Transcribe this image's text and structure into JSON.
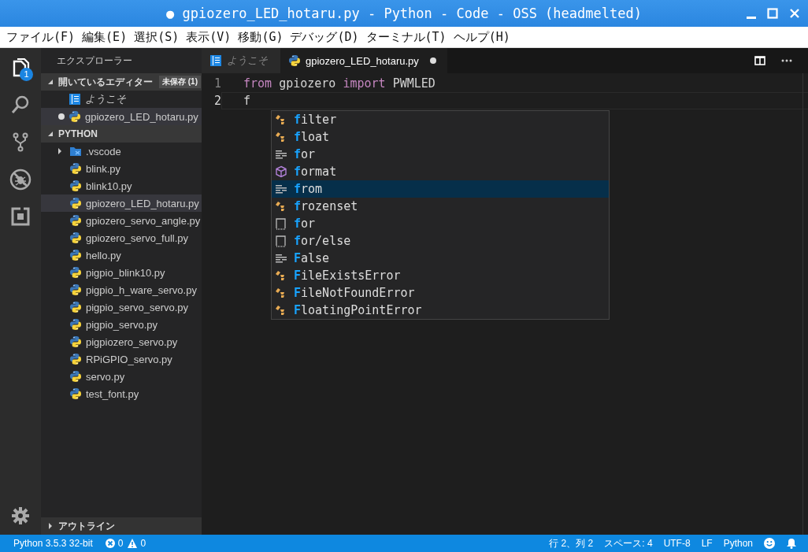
{
  "window": {
    "title": "● gpiozero_LED_hotaru.py - Python - Code - OSS (headmelted)"
  },
  "menu": [
    "ファイル(F)",
    "編集(E)",
    "選択(S)",
    "表示(V)",
    "移動(G)",
    "デバッグ(D)",
    "ターミナル(T)",
    "ヘルプ(H)"
  ],
  "activity_bar": {
    "explorer_badge": "1"
  },
  "sidebar": {
    "title": "エクスプローラー",
    "open_editors": {
      "label": "開いているエディター",
      "badge": "未保存 (1)",
      "expanded": true,
      "items": [
        {
          "name": "ようこそ",
          "kind": "welcome",
          "italic": true,
          "dirty": false,
          "selected": false
        },
        {
          "name": "gpiozero_LED_hotaru.py",
          "kind": "python",
          "italic": false,
          "dirty": true,
          "selected": true
        }
      ]
    },
    "folder": {
      "label": "PYTHON",
      "expanded": true,
      "items": [
        {
          "name": ".vscode",
          "kind": "folder",
          "expanded": false,
          "selected": false
        },
        {
          "name": "blink.py",
          "kind": "python",
          "selected": false
        },
        {
          "name": "blink10.py",
          "kind": "python",
          "selected": false
        },
        {
          "name": "gpiozero_LED_hotaru.py",
          "kind": "python",
          "selected": true
        },
        {
          "name": "gpiozero_servo_angle.py",
          "kind": "python",
          "selected": false
        },
        {
          "name": "gpiozero_servo_full.py",
          "kind": "python",
          "selected": false
        },
        {
          "name": "hello.py",
          "kind": "python",
          "selected": false
        },
        {
          "name": "pigpio_blink10.py",
          "kind": "python",
          "selected": false
        },
        {
          "name": "pigpio_h_ware_servo.py",
          "kind": "python",
          "selected": false
        },
        {
          "name": "pigpio_servo_servo.py",
          "kind": "python",
          "selected": false
        },
        {
          "name": "pigpio_servo.py",
          "kind": "python",
          "selected": false
        },
        {
          "name": "pigpiozero_servo.py",
          "kind": "python",
          "selected": false
        },
        {
          "name": "RPiGPIO_servo.py",
          "kind": "python",
          "selected": false
        },
        {
          "name": "servo.py",
          "kind": "python",
          "selected": false
        },
        {
          "name": "test_font.py",
          "kind": "python",
          "selected": false
        }
      ]
    },
    "outline": {
      "label": "アウトライン",
      "expanded": false
    }
  },
  "tabs": [
    {
      "label": "ようこそ",
      "kind": "welcome",
      "italic": true,
      "dirty": false,
      "selected": false
    },
    {
      "label": "gpiozero_LED_hotaru.py",
      "kind": "python",
      "italic": false,
      "dirty": true,
      "selected": true
    }
  ],
  "editor": {
    "lines": [
      {
        "number": "1",
        "current": false,
        "tokens": [
          {
            "text": "from",
            "kind": "keyword"
          },
          {
            "text": " gpiozero ",
            "kind": "plain"
          },
          {
            "text": "import",
            "kind": "keyword"
          },
          {
            "text": " PWMLED",
            "kind": "plain"
          }
        ]
      },
      {
        "number": "2",
        "current": true,
        "tokens": [
          {
            "text": "f",
            "kind": "plain"
          }
        ]
      }
    ],
    "suggestions": [
      {
        "match": "f",
        "rest": "ilter",
        "kind": "class",
        "selected": false
      },
      {
        "match": "f",
        "rest": "loat",
        "kind": "class",
        "selected": false
      },
      {
        "match": "f",
        "rest": "or",
        "kind": "keyword",
        "selected": false
      },
      {
        "match": "f",
        "rest": "ormat",
        "kind": "module",
        "selected": false
      },
      {
        "match": "f",
        "rest": "rom",
        "kind": "keyword",
        "selected": true
      },
      {
        "match": "f",
        "rest": "rozenset",
        "kind": "class",
        "selected": false
      },
      {
        "match": "f",
        "rest": "or",
        "kind": "snippet",
        "selected": false
      },
      {
        "match": "f",
        "rest": "or/else",
        "kind": "snippet",
        "selected": false
      },
      {
        "match": "F",
        "rest": "alse",
        "kind": "keyword",
        "selected": false
      },
      {
        "match": "F",
        "rest": "ileExistsError",
        "kind": "class",
        "selected": false
      },
      {
        "match": "F",
        "rest": "ileNotFoundError",
        "kind": "class",
        "selected": false
      },
      {
        "match": "F",
        "rest": "loatingPointError",
        "kind": "class",
        "selected": false
      }
    ]
  },
  "status_bar": {
    "interpreter": "Python 3.5.3 32-bit",
    "errors": "0",
    "warnings": "0",
    "position": "行 2、列 2",
    "indent": "スペース: 4",
    "encoding": "UTF-8",
    "eol": "LF",
    "language": "Python"
  }
}
